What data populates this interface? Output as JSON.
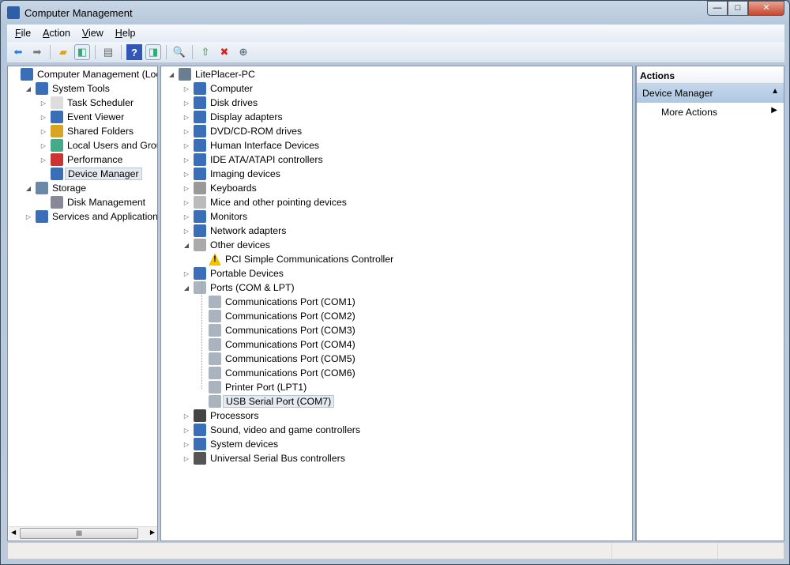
{
  "window": {
    "title": "Computer Management",
    "min": "—",
    "max": "□",
    "close": "✕"
  },
  "menu": [
    "File",
    "Action",
    "View",
    "Help"
  ],
  "toolbar": [
    "back-icon",
    "forward-icon",
    "up-folder-icon",
    "show-hide-console-tree-icon",
    "properties-icon",
    "help-icon",
    "show-hide-action-pane-icon",
    "scan-hardware-icon",
    "update-driver-icon",
    "uninstall-icon",
    "disable-icon"
  ],
  "left_tree": [
    {
      "label": "Computer Management (Local",
      "level": 0,
      "exp": "",
      "icon": "computer-management-icon"
    },
    {
      "label": "System Tools",
      "level": 1,
      "exp": "◢",
      "icon": "system-tools-icon"
    },
    {
      "label": "Task Scheduler",
      "level": 2,
      "exp": "▷",
      "icon": "clock-icon"
    },
    {
      "label": "Event Viewer",
      "level": 2,
      "exp": "▷",
      "icon": "event-viewer-icon"
    },
    {
      "label": "Shared Folders",
      "level": 2,
      "exp": "▷",
      "icon": "shared-folder-icon"
    },
    {
      "label": "Local Users and Groups",
      "level": 2,
      "exp": "▷",
      "icon": "users-icon"
    },
    {
      "label": "Performance",
      "level": 2,
      "exp": "▷",
      "icon": "performance-icon"
    },
    {
      "label": "Device Manager",
      "level": 2,
      "exp": "",
      "icon": "device-manager-icon",
      "selected": true
    },
    {
      "label": "Storage",
      "level": 1,
      "exp": "◢",
      "icon": "storage-icon"
    },
    {
      "label": "Disk Management",
      "level": 2,
      "exp": "",
      "icon": "disk-icon"
    },
    {
      "label": "Services and Applications",
      "level": 1,
      "exp": "▷",
      "icon": "services-icon"
    }
  ],
  "device_tree": [
    {
      "label": "LitePlacer-PC",
      "level": 0,
      "exp": "◢",
      "icon": "pc-icon"
    },
    {
      "label": "Computer",
      "level": 1,
      "exp": "▷",
      "icon": "computer-icon"
    },
    {
      "label": "Disk drives",
      "level": 1,
      "exp": "▷",
      "icon": "disk-drive-icon"
    },
    {
      "label": "Display adapters",
      "level": 1,
      "exp": "▷",
      "icon": "display-icon"
    },
    {
      "label": "DVD/CD-ROM drives",
      "level": 1,
      "exp": "▷",
      "icon": "dvd-icon"
    },
    {
      "label": "Human Interface Devices",
      "level": 1,
      "exp": "▷",
      "icon": "hid-icon"
    },
    {
      "label": "IDE ATA/ATAPI controllers",
      "level": 1,
      "exp": "▷",
      "icon": "ide-icon"
    },
    {
      "label": "Imaging devices",
      "level": 1,
      "exp": "▷",
      "icon": "camera-icon"
    },
    {
      "label": "Keyboards",
      "level": 1,
      "exp": "▷",
      "icon": "keyboard-icon"
    },
    {
      "label": "Mice and other pointing devices",
      "level": 1,
      "exp": "▷",
      "icon": "mouse-icon"
    },
    {
      "label": "Monitors",
      "level": 1,
      "exp": "▷",
      "icon": "monitor-icon"
    },
    {
      "label": "Network adapters",
      "level": 1,
      "exp": "▷",
      "icon": "network-icon"
    },
    {
      "label": "Other devices",
      "level": 1,
      "exp": "◢",
      "icon": "unknown-device-icon"
    },
    {
      "label": "PCI Simple Communications Controller",
      "level": 2,
      "exp": "",
      "icon": "warning-icon"
    },
    {
      "label": "Portable Devices",
      "level": 1,
      "exp": "▷",
      "icon": "portable-device-icon"
    },
    {
      "label": "Ports (COM & LPT)",
      "level": 1,
      "exp": "◢",
      "icon": "port-icon"
    },
    {
      "label": "Communications Port (COM1)",
      "level": 2,
      "exp": "",
      "icon": "port-icon"
    },
    {
      "label": "Communications Port (COM2)",
      "level": 2,
      "exp": "",
      "icon": "port-icon"
    },
    {
      "label": "Communications Port (COM3)",
      "level": 2,
      "exp": "",
      "icon": "port-icon"
    },
    {
      "label": "Communications Port (COM4)",
      "level": 2,
      "exp": "",
      "icon": "port-icon"
    },
    {
      "label": "Communications Port (COM5)",
      "level": 2,
      "exp": "",
      "icon": "port-icon"
    },
    {
      "label": "Communications Port (COM6)",
      "level": 2,
      "exp": "",
      "icon": "port-icon"
    },
    {
      "label": "Printer Port (LPT1)",
      "level": 2,
      "exp": "",
      "icon": "port-icon"
    },
    {
      "label": "USB Serial Port (COM7)",
      "level": 2,
      "exp": "",
      "icon": "port-icon",
      "selected": true
    },
    {
      "label": "Processors",
      "level": 1,
      "exp": "▷",
      "icon": "processor-icon"
    },
    {
      "label": "Sound, video and game controllers",
      "level": 1,
      "exp": "▷",
      "icon": "sound-icon"
    },
    {
      "label": "System devices",
      "level": 1,
      "exp": "▷",
      "icon": "system-device-icon"
    },
    {
      "label": "Universal Serial Bus controllers",
      "level": 1,
      "exp": "▷",
      "icon": "usb-icon"
    }
  ],
  "actions": {
    "header": "Actions",
    "section": "Device Manager",
    "item": "More Actions"
  },
  "scrollbar": {
    "grip": "III"
  }
}
